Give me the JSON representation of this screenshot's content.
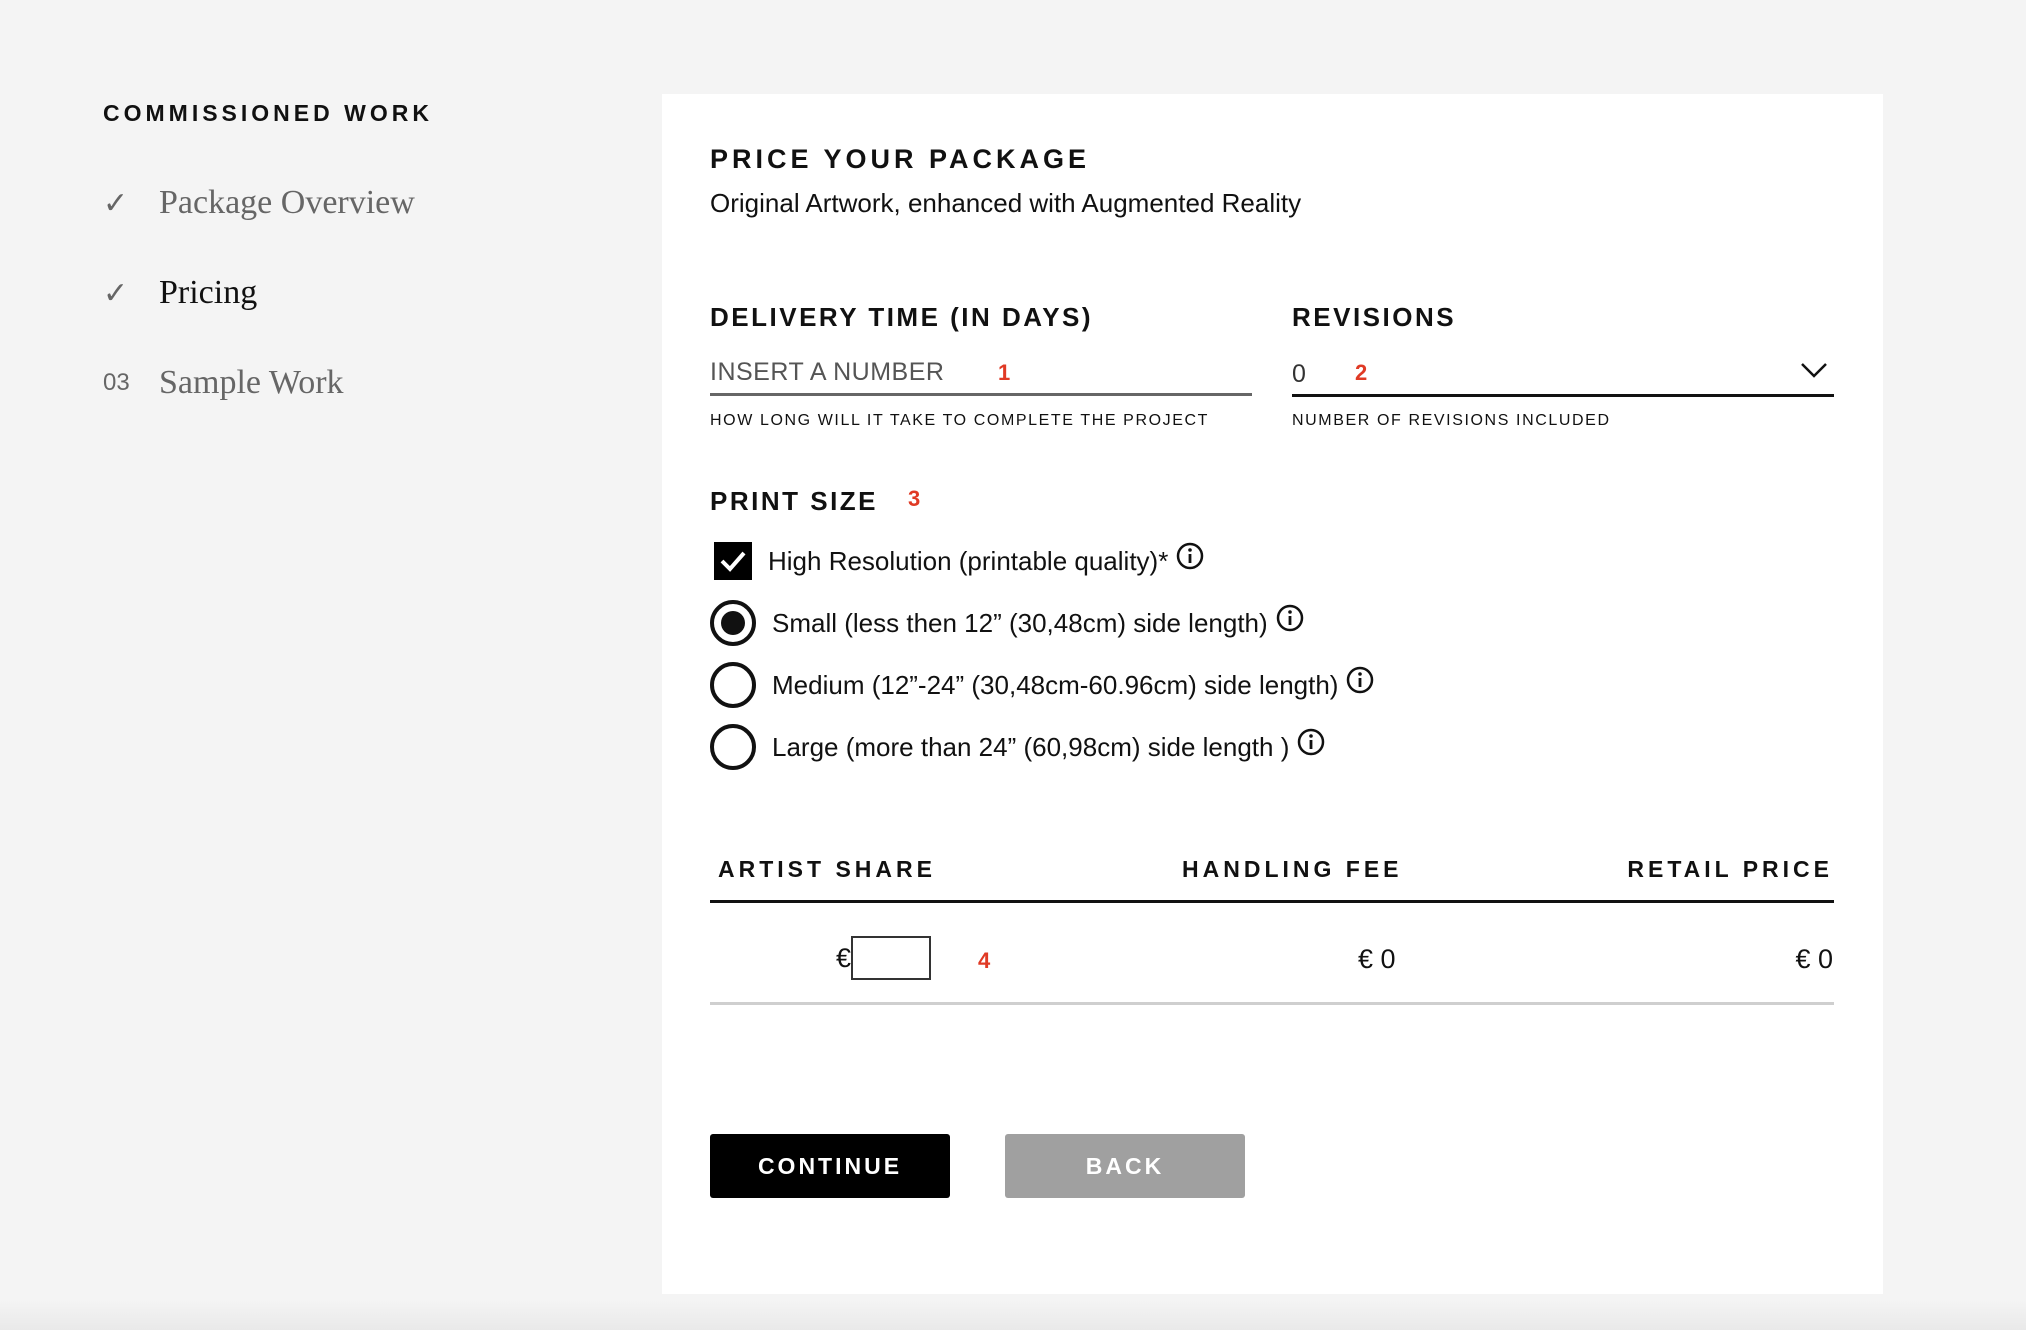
{
  "sidebar": {
    "title": "COMMISSIONED WORK",
    "steps": [
      {
        "marker": "✓",
        "label": "Package Overview",
        "state": "done"
      },
      {
        "marker": "✓",
        "label": "Pricing",
        "state": "active"
      },
      {
        "marker": "03",
        "label": "Sample Work",
        "state": "todo"
      }
    ]
  },
  "main": {
    "title": "PRICE YOUR PACKAGE",
    "subtitle": "Original Artwork, enhanced with Augmented Reality",
    "delivery": {
      "label": "DELIVERY TIME (IN DAYS)",
      "placeholder": "INSERT A NUMBER",
      "value": "",
      "help": "HOW LONG WILL IT TAKE TO COMPLETE THE PROJECT",
      "annotation": "1"
    },
    "revisions": {
      "label": "REVISIONS",
      "value": "0",
      "help": "NUMBER OF REVISIONS INCLUDED",
      "annotation": "2"
    },
    "print_size": {
      "label": "PRINT SIZE",
      "annotation": "3",
      "high_res": {
        "label": "High Resolution (printable quality)*",
        "checked": true
      },
      "options": [
        {
          "label": "Small (less then 12” (30,48cm) side length)",
          "selected": true
        },
        {
          "label": "Medium (12”-24” (30,48cm-60.96cm) side length)",
          "selected": false
        },
        {
          "label": "Large (more than 24” (60,98cm) side length )",
          "selected": false
        }
      ]
    },
    "pricing_table": {
      "headers": {
        "artist_share": "ARTIST SHARE",
        "handling_fee": "HANDLING FEE",
        "retail_price": "RETAIL PRICE"
      },
      "currency": "€",
      "artist_share_value": "",
      "annotation": "4",
      "handling_fee": "€ 0",
      "retail_price": "€ 0"
    },
    "buttons": {
      "continue": "CONTINUE",
      "back": "BACK"
    }
  },
  "colors": {
    "accent": "#000000",
    "annotation": "#e03a25",
    "secondary_button": "#a0a0a0",
    "background": "#f4f4f4"
  }
}
